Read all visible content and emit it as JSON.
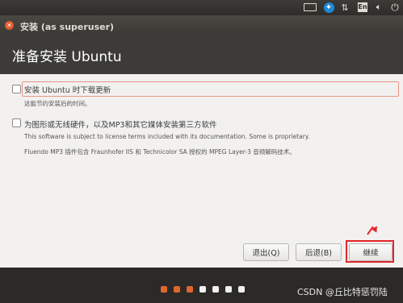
{
  "window": {
    "title": "安装 (as superuser)"
  },
  "header": {
    "title": "准备安装 Ubuntu"
  },
  "options": [
    {
      "label": "安装 Ubuntu 时下载更新",
      "description": "这能节约安装后的时间。",
      "checked": false
    },
    {
      "label": "为图形或无线硬件，以及MP3和其它媒体安装第三方软件",
      "description": "This software is subject to license terms included with its documentation. Some is proprietary.",
      "note": "Fluendo MP3 插件包含 Fraunhofer IIS 和 Technicolor SA 授权的 MPEG Layer-3 音频解码技术。",
      "checked": false
    }
  ],
  "buttons": {
    "quit": "退出(Q)",
    "back": "后退(B)",
    "continue": "继续"
  },
  "progress": {
    "total_steps": 7,
    "completed_steps": 3,
    "active_color": "#e0662f",
    "inactive_color": "#f0f0f0"
  },
  "tray": {
    "keyboard_icon": "keyboard-icon",
    "accessibility_icon": "accessibility-icon",
    "network_icon": "network-arrows-icon",
    "language": "En",
    "volume_icon": "speaker-icon",
    "power_icon": "power-icon"
  },
  "watermark": "CSDN @丘比特惩罚陆",
  "colors": {
    "panel": "#3c3b37",
    "content_bg": "#f2f1f0",
    "accent": "#e35a2b",
    "highlight": "#e0262a"
  }
}
